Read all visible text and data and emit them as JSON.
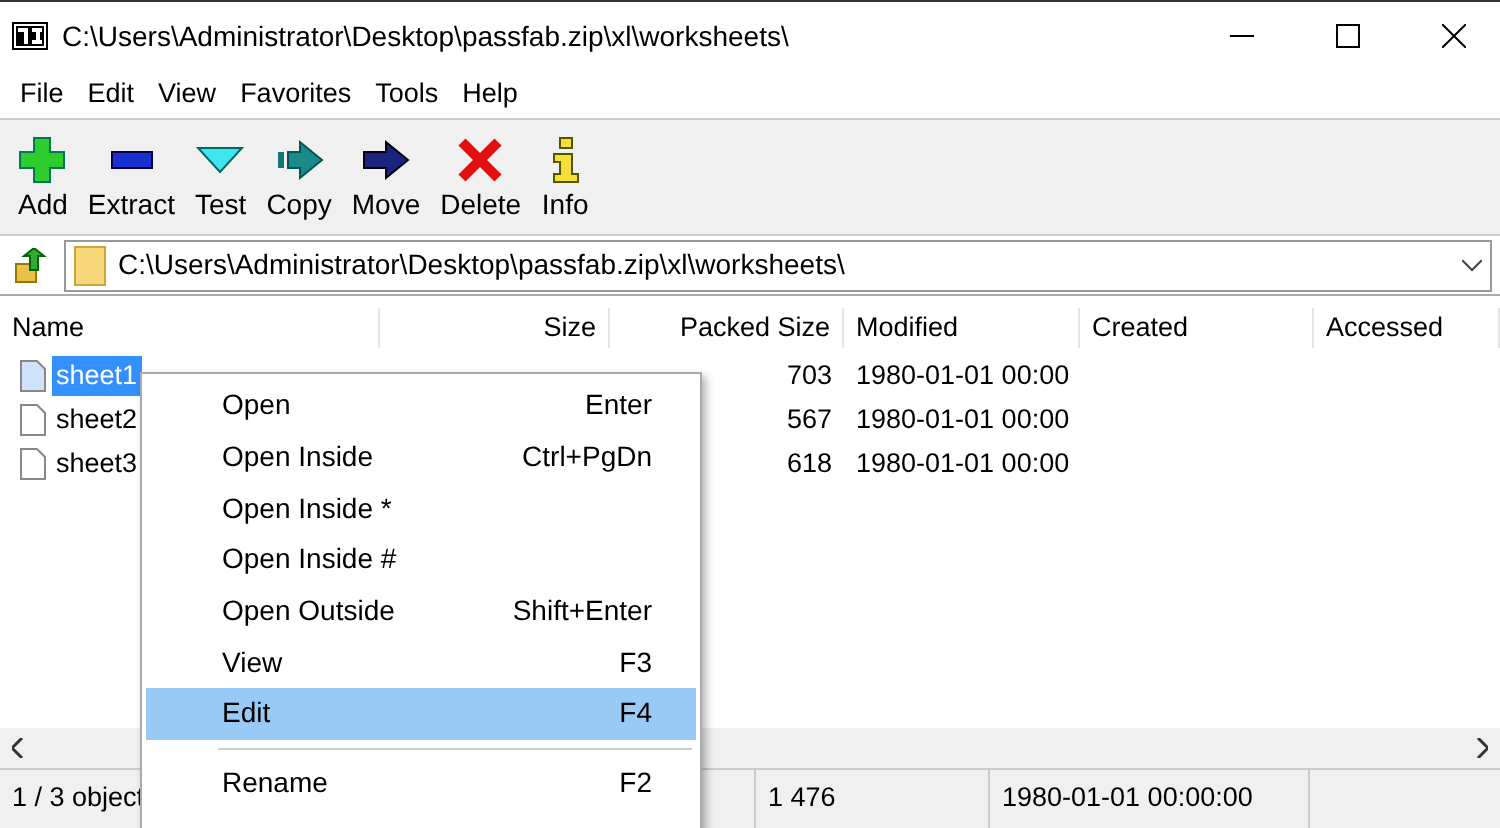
{
  "window": {
    "title": "C:\\Users\\Administrator\\Desktop\\passfab.zip\\xl\\worksheets\\"
  },
  "menu_bar": [
    "File",
    "Edit",
    "View",
    "Favorites",
    "Tools",
    "Help"
  ],
  "toolbar": [
    {
      "label": "Add",
      "kind": "add"
    },
    {
      "label": "Extract",
      "kind": "extract"
    },
    {
      "label": "Test",
      "kind": "test"
    },
    {
      "label": "Copy",
      "kind": "copy"
    },
    {
      "label": "Move",
      "kind": "move"
    },
    {
      "label": "Delete",
      "kind": "delete"
    },
    {
      "label": "Info",
      "kind": "info"
    }
  ],
  "address_bar": {
    "value": "C:\\Users\\Administrator\\Desktop\\passfab.zip\\xl\\worksheets\\"
  },
  "table": {
    "columns": [
      "Name",
      "Size",
      "Packed Size",
      "Modified",
      "Created",
      "Accessed"
    ],
    "rows": [
      {
        "name": "sheet1",
        "packed_size": "703",
        "modified": "1980-01-01 00:00",
        "selected": true
      },
      {
        "name": "sheet2",
        "packed_size": "567",
        "modified": "1980-01-01 00:00",
        "selected": false
      },
      {
        "name": "sheet3",
        "packed_size": "618",
        "modified": "1980-01-01 00:00",
        "selected": false
      }
    ]
  },
  "context_menu": [
    {
      "label": "Open",
      "shortcut": "Enter",
      "selected": false
    },
    {
      "label": "Open Inside",
      "shortcut": "Ctrl+PgDn",
      "selected": false
    },
    {
      "label": "Open Inside *",
      "selected": false
    },
    {
      "label": "Open Inside #",
      "selected": false
    },
    {
      "label": "Open Outside",
      "shortcut": "Shift+Enter",
      "selected": false
    },
    {
      "label": "View",
      "shortcut": "F3",
      "selected": false
    },
    {
      "label": "Edit",
      "shortcut": "F4",
      "selected": true
    },
    {
      "kind": "separator"
    },
    {
      "label": "Rename",
      "shortcut": "F2",
      "selected": false
    }
  ],
  "status_bar": [
    "1 / 3 object",
    "1 476",
    "1980-01-01 00:00:00"
  ]
}
